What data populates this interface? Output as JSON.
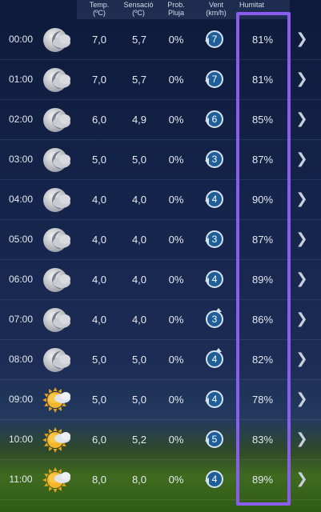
{
  "header": {
    "temp": "Temp.",
    "temp_unit": "(ºC)",
    "feel": "Sensació",
    "feel_unit": "(ºC)",
    "rain": "Prob.",
    "rain_sub": "Pluja",
    "wind": "Vent",
    "wind_unit": "(km/h)",
    "humidity": "Humitat"
  },
  "rows": [
    {
      "time": "00:00",
      "icon": "moon-cloud-icon",
      "temp": "7,0",
      "feel": "5,7",
      "rain": "0%",
      "wind": "7",
      "wind_dir": "left",
      "humidity": "81%"
    },
    {
      "time": "01:00",
      "icon": "moon-cloud-icon",
      "temp": "7,0",
      "feel": "5,7",
      "rain": "0%",
      "wind": "7",
      "wind_dir": "left",
      "humidity": "81%"
    },
    {
      "time": "02:00",
      "icon": "moon-cloud-icon",
      "temp": "6,0",
      "feel": "4,9",
      "rain": "0%",
      "wind": "6",
      "wind_dir": "left",
      "humidity": "85%"
    },
    {
      "time": "03:00",
      "icon": "moon-cloud-icon",
      "temp": "5,0",
      "feel": "5,0",
      "rain": "0%",
      "wind": "3",
      "wind_dir": "left",
      "humidity": "87%"
    },
    {
      "time": "04:00",
      "icon": "moon-cloud-icon",
      "temp": "4,0",
      "feel": "4,0",
      "rain": "0%",
      "wind": "4",
      "wind_dir": "left",
      "humidity": "90%"
    },
    {
      "time": "05:00",
      "icon": "moon-cloud-icon",
      "temp": "4,0",
      "feel": "4,0",
      "rain": "0%",
      "wind": "3",
      "wind_dir": "left",
      "humidity": "87%"
    },
    {
      "time": "06:00",
      "icon": "moon-cloud-icon",
      "temp": "4,0",
      "feel": "4,0",
      "rain": "0%",
      "wind": "4",
      "wind_dir": "left",
      "humidity": "89%"
    },
    {
      "time": "07:00",
      "icon": "moon-cloud-icon",
      "temp": "4,0",
      "feel": "4,0",
      "rain": "0%",
      "wind": "3",
      "wind_dir": "up",
      "humidity": "86%"
    },
    {
      "time": "08:00",
      "icon": "moon-cloud-icon",
      "temp": "5,0",
      "feel": "5,0",
      "rain": "0%",
      "wind": "4",
      "wind_dir": "up",
      "humidity": "82%"
    },
    {
      "time": "09:00",
      "icon": "sun-cloud-icon",
      "temp": "5,0",
      "feel": "5,0",
      "rain": "0%",
      "wind": "4",
      "wind_dir": "left",
      "humidity": "78%"
    },
    {
      "time": "10:00",
      "icon": "sun-cloud-icon",
      "temp": "6,0",
      "feel": "5,2",
      "rain": "0%",
      "wind": "5",
      "wind_dir": "left",
      "humidity": "83%"
    },
    {
      "time": "11:00",
      "icon": "sun-cloud-icon",
      "temp": "8,0",
      "feel": "8,0",
      "rain": "0%",
      "wind": "4",
      "wind_dir": "left",
      "humidity": "89%"
    }
  ],
  "colors": {
    "highlight": "#8a5cf0",
    "wind_badge": "#1f5f99"
  }
}
